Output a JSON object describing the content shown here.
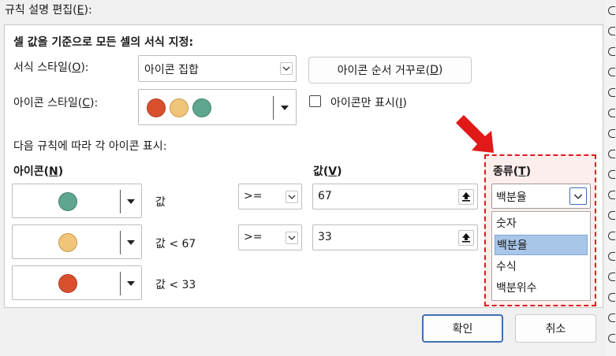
{
  "dialog": {
    "title_label": "규칙 설명 편집(",
    "title_key": "E",
    "title_end": "):"
  },
  "panel": {
    "heading": "셀 값을 기준으로 모든 셀의 서식 지정:",
    "format_style": {
      "label": "서식 스타일(",
      "key": "O",
      "end": "):",
      "value": "아이콘 집합"
    },
    "reverse_button": {
      "label": "아이콘 순서 거꾸로(",
      "key": "D",
      "end": ")"
    },
    "icon_style": {
      "label": "아이콘 스타일(",
      "key": "C",
      "end": "):"
    },
    "icon_only": {
      "label": "아이콘만 표시(",
      "key": "I",
      "end": ")",
      "checked": false
    },
    "rule_caption": "다음 규칙에 따라 각 아이콘 표시:",
    "icon_header": {
      "label": "아이콘(",
      "key": "N",
      "end": ")"
    },
    "value_header": {
      "label": "값(",
      "key": "V",
      "end": ")"
    },
    "type_header": {
      "label": "종류(",
      "key": "T",
      "end": ")"
    },
    "rules": [
      {
        "icon": "green-circle",
        "condition": "값",
        "operator": ">=",
        "value": "67"
      },
      {
        "icon": "yellow-circle",
        "condition": "값 < 67",
        "operator": ">=",
        "value": "33"
      },
      {
        "icon": "red-circle",
        "condition": "값 < 33"
      }
    ],
    "type_select": {
      "value": "백분율",
      "options": [
        "숫자",
        "백분율",
        "수식",
        "백분위수"
      ],
      "selected_index": 1
    }
  },
  "buttons": {
    "ok": "확인",
    "cancel": "취소"
  },
  "colors": {
    "red": "#d9502f",
    "yellow": "#f0c57a",
    "green": "#5fa690",
    "arrow": "#e11919",
    "highlight": "#a8c6e8"
  }
}
